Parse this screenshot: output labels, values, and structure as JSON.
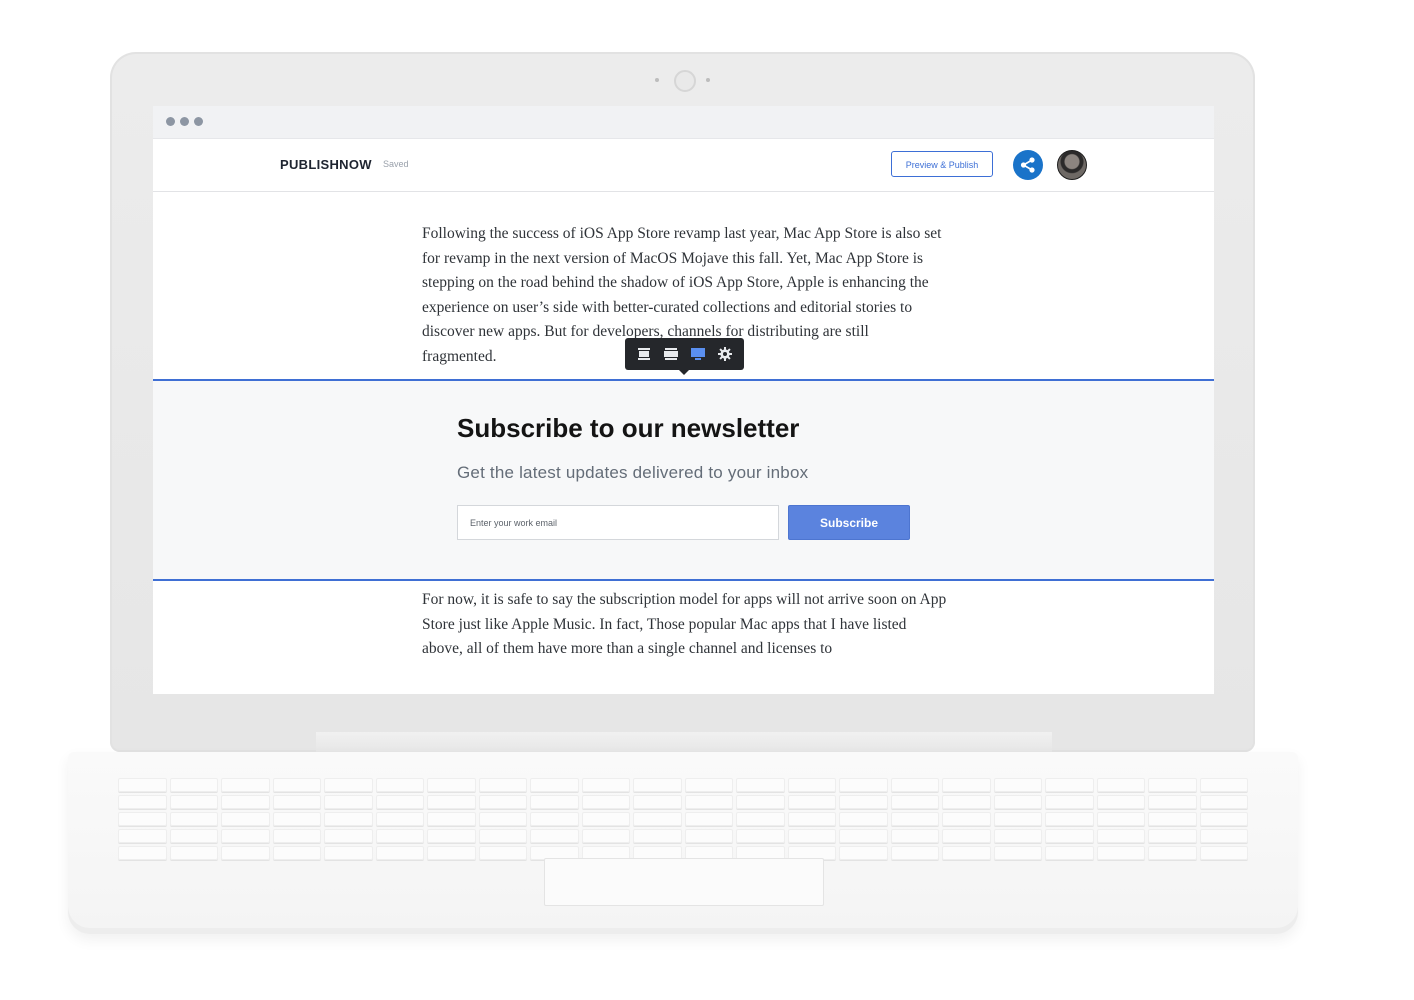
{
  "app": {
    "brand": "PUBLISHNOW",
    "status": "Saved",
    "preview_publish_label": "Preview & Publish",
    "accent_color": "#3d6fd6",
    "share_color": "#1a73c9"
  },
  "article": {
    "paragraph_before": "Following the success of iOS App Store revamp last year, Mac App Store is also set for revamp in the next version of MacOS Mojave this fall. Yet, Mac App Store is stepping on the road behind the shadow of iOS App Store, Apple is enhancing the experience on user’s side with better-curated collections and editorial stories to discover new apps. But for developers, channels for distributing are still fragmented.",
    "paragraph_after": "For now, it is safe to say the subscription model for apps will not arrive soon on App Store just like Apple Music. In fact, Those popular Mac apps that I have listed above, all of them have more than a single channel and licenses to"
  },
  "newsletter": {
    "title": "Subscribe to our newsletter",
    "subtitle": "Get the latest updates delivered to your inbox",
    "email_placeholder": "Enter your work email",
    "email_value": "",
    "button_label": "Subscribe",
    "button_color": "#5b83de"
  },
  "block_toolbar": {
    "tools": [
      "layout-narrow-icon",
      "layout-wide-icon",
      "layout-full-icon",
      "gear-icon"
    ],
    "active_tool": "layout-full-icon"
  }
}
